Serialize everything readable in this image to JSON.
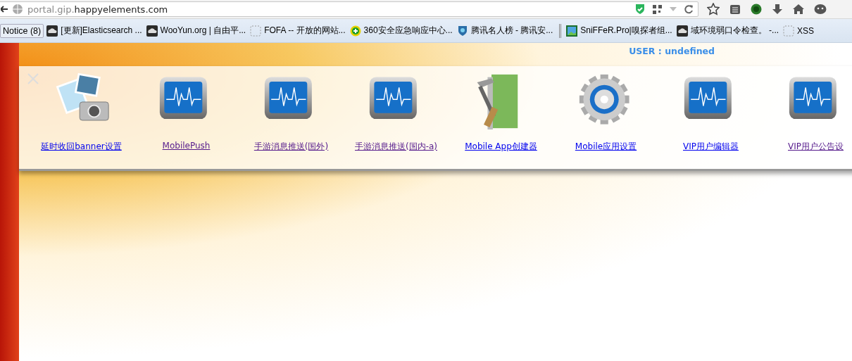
{
  "address_bar": {
    "host_prefix": "portal.gip.",
    "host_domain": "happyelements.com"
  },
  "bookmarks": [
    {
      "label": "Notice (8)",
      "kind": "folder"
    },
    {
      "label": "[更新]Elasticsearch ...",
      "kind": "cloud"
    },
    {
      "label": "WooYun.org | 自由平...",
      "kind": "cloud"
    },
    {
      "label": "FOFA -- 开放的网站...",
      "kind": "blank"
    },
    {
      "label": "360安全应急响应中心...",
      "kind": "plus"
    },
    {
      "label": "腾讯名人榜 - 腾讯安...",
      "kind": "shield"
    },
    {
      "label": "SniFFeR.Pro|嗅探者组...",
      "kind": "image"
    },
    {
      "label": "域环境弱口令检查。 -...",
      "kind": "cloud"
    },
    {
      "label": "XSS",
      "kind": "blank"
    }
  ],
  "user_label": "USER : undefined",
  "apps": [
    {
      "label": "延时收回banner设置",
      "kind": "photos",
      "visited": false
    },
    {
      "label": "MobilePush",
      "kind": "monitor",
      "visited": true
    },
    {
      "label": "手游消息推送(国外)",
      "kind": "monitor",
      "visited": true
    },
    {
      "label": "手游消息推送(国内-a)",
      "kind": "monitor",
      "visited": true
    },
    {
      "label": "Mobile App创建器",
      "kind": "tools",
      "visited": false
    },
    {
      "label": "Mobile应用设置",
      "kind": "gear",
      "visited": false
    },
    {
      "label": "VIP用户编辑器",
      "kind": "monitor",
      "visited": false
    },
    {
      "label": "VIP用户公告设",
      "kind": "monitor",
      "visited": true
    }
  ]
}
